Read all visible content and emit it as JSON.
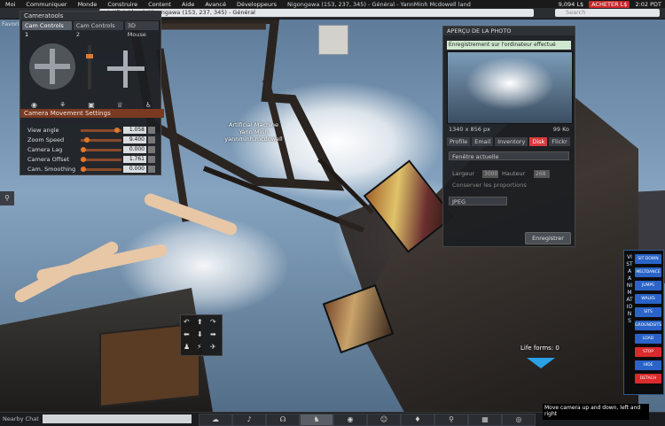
{
  "menubar": {
    "items": [
      "Moi",
      "Communiquer",
      "Monde",
      "Construire",
      "Content",
      "Aide",
      "Avancé",
      "Développeurs"
    ],
    "location": "Nigongawa (153, 237, 345) - Général - YannMinh Mcdowell land",
    "balance": "9,094 L$",
    "buy_label": "ACHETER L$",
    "time": "2:02 PDT"
  },
  "navbar": {
    "url": "Artificial land, Nigongawa (153, 237, 345) - Général",
    "search_placeholder": "Search"
  },
  "favbar": {
    "label": "Favori"
  },
  "camera_tools": {
    "title": "Cameratools",
    "tabs": [
      "Cam Controls 1",
      "Cam Controls 2",
      "3D Mouse"
    ],
    "settings_title": "Camera Movement Settings",
    "settings": [
      {
        "label": "View angle",
        "value": "1.058"
      },
      {
        "label": "Zoom Speed",
        "value": "9.400"
      },
      {
        "label": "Camera Lag",
        "value": "0.000"
      },
      {
        "label": "Camera Offset",
        "value": "1.761"
      },
      {
        "label": "Cam. Smoothing",
        "value": "0.000"
      }
    ],
    "icons": [
      "eye-icon",
      "walk-icon",
      "camera-icon",
      "trophy-icon",
      "person-icon"
    ]
  },
  "floating_label": {
    "line1": "Artificial Machine",
    "line2": "Yann Minh",
    "line3": "yannminh.mcdowell"
  },
  "photo_panel": {
    "title": "APERÇU DE LA PHOTO",
    "success_msg": "Enregistrement sur l'ordinateur effectué",
    "resolution": "1340 x 856 px",
    "size": "99 Ko",
    "tabs": [
      "Profile",
      "Email",
      "Inventory",
      "Disk",
      "Flickr"
    ],
    "active_tab": "Disk",
    "window_option": "Fenêtre actuelle",
    "width_label": "Largeur",
    "width_value": "3000",
    "height_label": "Hauteur",
    "height_value": "268",
    "keep_ratio": "Conserver les proportions",
    "format": "JPEG",
    "save_label": "Enregistrer"
  },
  "vista": {
    "title": "VISTA ANIMATIONS",
    "buttons": [
      {
        "label": "SIT DOWN",
        "color": "#2a64c8"
      },
      {
        "label": "MELTDANCE",
        "color": "#2a64c8"
      },
      {
        "label": "JUMPS",
        "color": "#2a64c8"
      },
      {
        "label": "WALKS",
        "color": "#2a64c8"
      },
      {
        "label": "SITS",
        "color": "#2a64c8"
      },
      {
        "label": "GROUNDSITS",
        "color": "#2a64c8"
      },
      {
        "label": "LOAD",
        "color": "#2a64c8"
      },
      {
        "label": "STOP",
        "color": "#d92b2b"
      },
      {
        "label": "HIDE",
        "color": "#2a64c8"
      },
      {
        "label": "DETACH",
        "color": "#d92b2b"
      }
    ]
  },
  "scene": {
    "life_forms": "Life forms: 0"
  },
  "bottombar": {
    "nearby_label": "Nearby Chat",
    "tooltip": "Move camera up and down, left and right"
  }
}
